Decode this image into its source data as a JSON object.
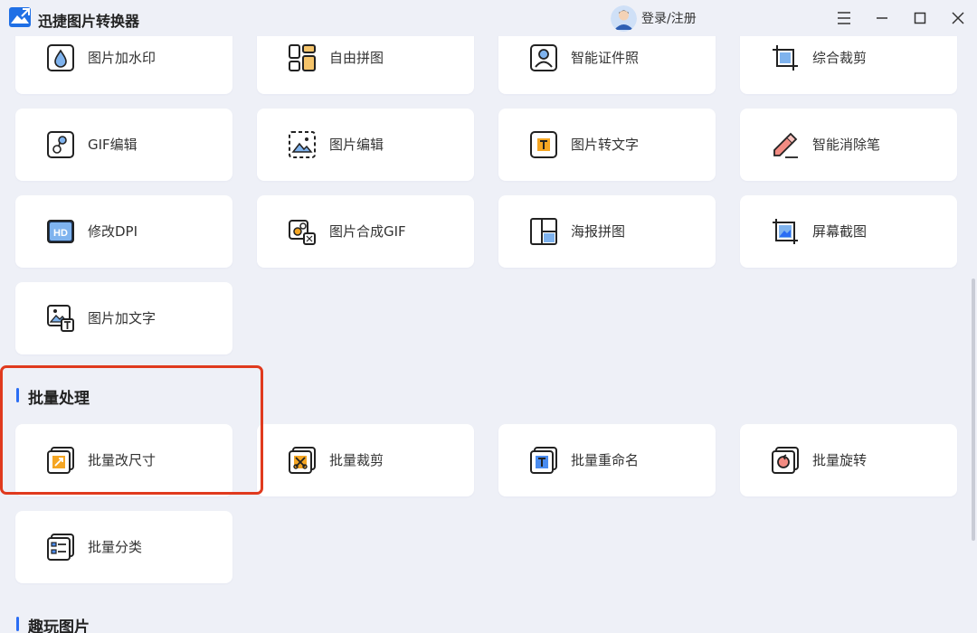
{
  "app": {
    "title": "迅捷图片转换器",
    "login_label": "登录/注册"
  },
  "tools_row1": [
    "图片加水印",
    "自由拼图",
    "智能证件照",
    "综合裁剪"
  ],
  "tools_row2": [
    "GIF编辑",
    "图片编辑",
    "图片转文字",
    "智能消除笔"
  ],
  "tools_row3": [
    "修改DPI",
    "图片合成GIF",
    "海报拼图",
    "屏幕截图"
  ],
  "tools_row4": [
    "图片加文字"
  ],
  "sections": {
    "batch": {
      "title": "批量处理",
      "items": [
        "批量改尺寸",
        "批量裁剪",
        "批量重命名",
        "批量旋转",
        "批量分类"
      ]
    },
    "fun": {
      "title": "趣玩图片"
    }
  },
  "colors": {
    "accent": "#2a6df4",
    "icon_orange": "#f5a623",
    "highlight": "#e03a1e",
    "background": "#eef0f7"
  }
}
